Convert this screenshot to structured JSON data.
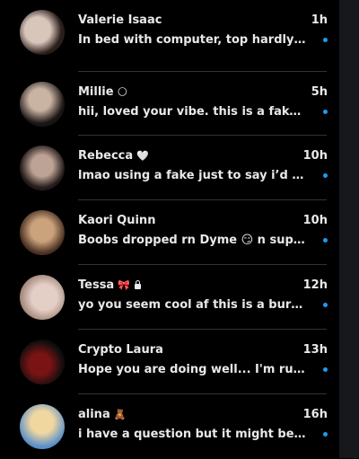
{
  "conversations": [
    {
      "name": "Valerie Isaac",
      "badge": "",
      "time": "1h",
      "preview": "In bed with computer, top hardly holdin...",
      "avatar_colors": [
        "#d8c6bb",
        "#2a1e1a"
      ]
    },
    {
      "name": "Millie",
      "badge": "🌕",
      "time": "5h",
      "preview": "hii, loved your vibe. this is a fake accou...",
      "avatar_colors": [
        "#c9b3a3",
        "#1a1413"
      ]
    },
    {
      "name": "Rebecca",
      "badge": "🤍",
      "time": "10h",
      "preview": "lmao using a fake just to say i’d drain y...",
      "avatar_colors": [
        "#bda395",
        "#241b1a"
      ]
    },
    {
      "name": "Kaori Quinn",
      "badge": "",
      "time": "10h",
      "preview": "Boobs dropped rn Dyme 😏 n  super ...",
      "avatar_colors": [
        "#caa27c",
        "#4a3022"
      ]
    },
    {
      "name": "Tessa",
      "badge": "🎀",
      "time": "12h",
      "preview": "yo you seem cool af this is a burner but...",
      "avatar_colors": [
        "#e4cfc6",
        "#a2877a"
      ]
    },
    {
      "name": "Crypto Laura",
      "badge": "",
      "time": "13h",
      "preview": "Hope you are doing well... I'm running ...",
      "avatar_colors": [
        "#7a1414",
        "#0d0d0d"
      ]
    },
    {
      "name": "alina",
      "badge": "🧸",
      "time": "16h",
      "preview": "i have a question but it might be too ...",
      "avatar_colors": [
        "#f0d7a0",
        "#5b8fc8"
      ]
    }
  ],
  "colors": {
    "unread_dot": "#1d9bf0",
    "divider": "#2f3336"
  }
}
